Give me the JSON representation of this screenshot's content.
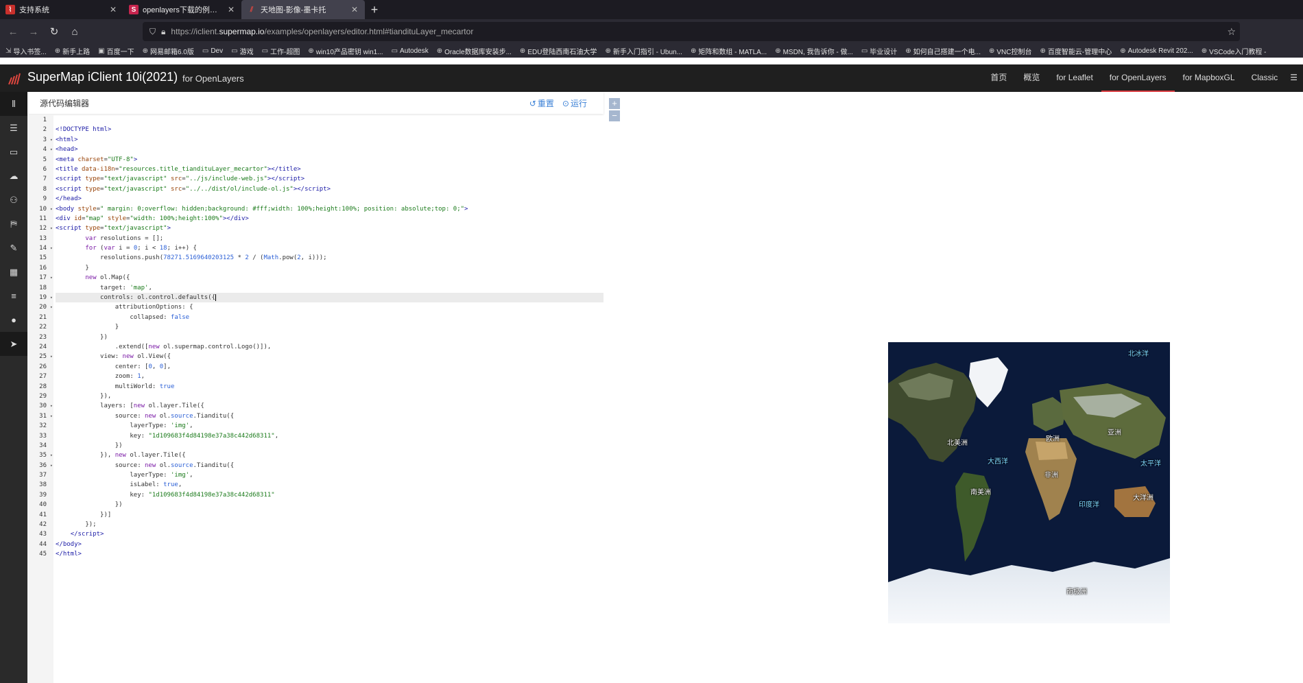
{
  "browser": {
    "tabs": [
      {
        "title": "支持系统",
        "active": false
      },
      {
        "title": "openlayers下载的例子中为什么",
        "active": false
      },
      {
        "title": "天地图-影像-墨卡托",
        "active": true
      }
    ],
    "url_prefix": "https://iclient.",
    "url_host": "supermap.io",
    "url_path": "/examples/openlayers/editor.html#tiandituLayer_mecartor",
    "bookmarks": [
      "导入书签...",
      "新手上路",
      "百度一下",
      "网易邮箱6.0版",
      "Dev",
      "游戏",
      "工作-超图",
      "win10产品密钥 win1...",
      "Autodesk",
      "Oracle数据库安装步...",
      "EDU登陆西南石油大学",
      "新手入门指引 - Ubun...",
      "矩阵和数组 - MATLA...",
      "MSDN, 我告诉你 - 做...",
      "毕业设计",
      "如何自己搭建一个电...",
      "VNC控制台",
      "百度智能云-管理中心",
      "Autodesk Revit 202...",
      "VSCode入门教程 -"
    ]
  },
  "app": {
    "brand": "SuperMap iClient 10i(2021)",
    "subtitle": "for OpenLayers",
    "nav": [
      "首页",
      "概览",
      "for Leaflet",
      "for OpenLayers",
      "for MapboxGL",
      "Classic"
    ],
    "active_nav": "for OpenLayers"
  },
  "editor": {
    "title": "源代码编辑器",
    "reset_label": "重置",
    "run_label": "运行"
  },
  "map": {
    "labels": [
      {
        "text": "北冰洋",
        "sea": true
      },
      {
        "text": "北美洲",
        "sea": false
      },
      {
        "text": "欧洲",
        "sea": false
      },
      {
        "text": "亚洲",
        "sea": false
      },
      {
        "text": "大西洋",
        "sea": true
      },
      {
        "text": "太平洋",
        "sea": true
      },
      {
        "text": "非洲",
        "sea": false
      },
      {
        "text": "南美洲",
        "sea": false
      },
      {
        "text": "印度洋",
        "sea": true
      },
      {
        "text": "大洋洲",
        "sea": false
      },
      {
        "text": "南极洲",
        "sea": false
      }
    ]
  },
  "colors": {
    "accent": "#d9393e",
    "link": "#3b80d6"
  }
}
